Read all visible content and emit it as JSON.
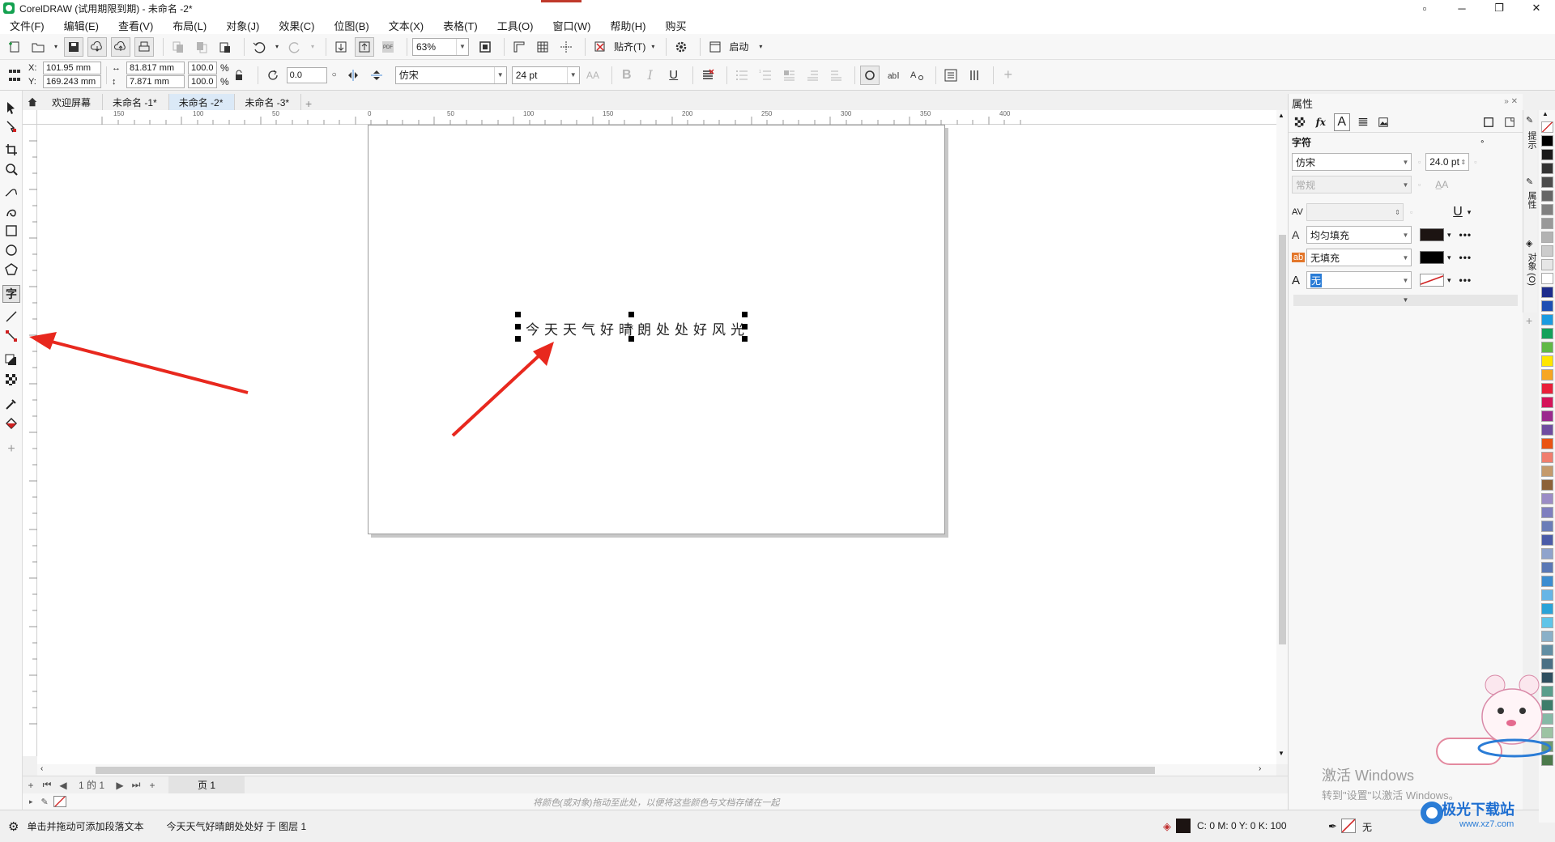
{
  "window": {
    "title": "CorelDRAW (试用期限到期) - 未命名 -2*",
    "controls": [
      "▫",
      "─",
      "❐",
      "✕"
    ]
  },
  "menu": [
    "文件(F)",
    "编辑(E)",
    "查看(V)",
    "布局(L)",
    "对象(J)",
    "效果(C)",
    "位图(B)",
    "文本(X)",
    "表格(T)",
    "工具(O)",
    "窗口(W)",
    "帮助(H)",
    "购买"
  ],
  "standard_toolbar": {
    "zoom_value": "63%",
    "snap_label": "贴齐(T)",
    "launch_label": "启动"
  },
  "property_bar": {
    "x_label": "X:",
    "y_label": "Y:",
    "x_value": "101.95 mm",
    "y_value": "169.243 mm",
    "width_value": "81.817 mm",
    "height_value": "7.871 mm",
    "scale_x": "100.0",
    "scale_y": "100.0",
    "percent": "%",
    "rotation": "0.0",
    "font_name": "仿宋",
    "font_size": "24 pt",
    "bold": "B",
    "italic": "I",
    "underline": "U"
  },
  "doc_tabs": [
    "欢迎屏幕",
    "未命名 -1*",
    "未命名 -2*",
    "未命名 -3*"
  ],
  "active_tab_index": 2,
  "ruler_labels": [
    "150",
    "100",
    "50",
    "0",
    "50",
    "100",
    "150",
    "200",
    "250",
    "300",
    "350",
    "400"
  ],
  "canvas": {
    "text": "今天天气好晴朗处处好风光",
    "center_mark": "×"
  },
  "page_nav": {
    "page_count_text": "1 的 1",
    "page_tab": "页 1"
  },
  "doc_palette_hint": "将颜色(或对象)拖动至此处，以便将这些颜色与文档存储在一起",
  "status": {
    "hint": "单击并拖动可添加段落文本",
    "object_info": "今天天气好晴朗处处好 于 图层 1",
    "fill_cmyk": "C:  0 M:  0 Y:  0 K:  100",
    "outline": "无"
  },
  "docker": {
    "title": "属性",
    "section": "字符",
    "font_name": "仿宋",
    "font_size": "24.0 pt",
    "font_style": "常规",
    "text_fill": "均匀填充",
    "bg_fill": "无填充",
    "outline": "无",
    "underline": "U",
    "more": "•••"
  },
  "vertical_tabs": [
    "提示",
    "属性",
    "对象 (O)"
  ],
  "palette_colors": [
    "#ffffff",
    "#000000",
    "#1a1a1a",
    "#333333",
    "#4d4d4d",
    "#666666",
    "#808080",
    "#999999",
    "#b3b3b3",
    "#cccccc",
    "#e6e6e6",
    "#ffffff",
    "#1d2c8c",
    "#1e4fb3",
    "#1a9be0",
    "#13a15a",
    "#60b946",
    "#ffe600",
    "#f6a623",
    "#e9203a",
    "#d4145a",
    "#9b2a8e",
    "#6f4da0",
    "#ea5413",
    "#f07e6e",
    "#c49a6c",
    "#8c6239",
    "#9b8cc6",
    "#7f7fbf",
    "#6b7db8",
    "#4b5ca8",
    "#8fa3cc",
    "#5a78b5",
    "#3c8dd0",
    "#67b5e6",
    "#2aa3d8",
    "#5fc4e8",
    "#8ab0c8",
    "#628ea3",
    "#4b7084",
    "#2f4f5f",
    "#5a9e8c",
    "#3d7d6a",
    "#85b9a6",
    "#9cc3a3",
    "#6f9b6f",
    "#4c7a4c"
  ],
  "overlay": {
    "activate_line1": "激活 Windows",
    "activate_line2": "转到\"设置\"以激活 Windows。",
    "brand": "极光下载站",
    "brand_sub": "www.xz7.com"
  }
}
